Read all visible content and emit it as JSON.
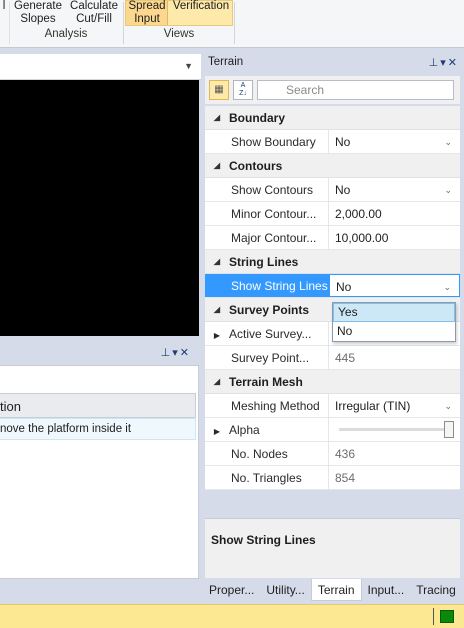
{
  "ribbon": {
    "partial_label": "l",
    "generate_slopes_label": "Generate\nSlopes",
    "calculate_cutfill_label": "Calculate\nCut/Fill",
    "spread_input_label": "Spread\nInput",
    "verification_label": "Verification",
    "analysis_group": "Analysis",
    "views_group": "Views"
  },
  "lower_grid": {
    "header": "tion",
    "row": "nove the platform inside it"
  },
  "dock": {
    "title": "Terrain",
    "search_placeholder": "Search",
    "categories": {
      "boundary": "Boundary",
      "contours": "Contours",
      "string_lines": "String Lines",
      "survey_points": "Survey Points",
      "terrain_mesh": "Terrain Mesh"
    },
    "props": {
      "show_boundary": {
        "name": "Show Boundary",
        "value": "No"
      },
      "show_contours": {
        "name": "Show Contours",
        "value": "No"
      },
      "minor_contour": {
        "name": "Minor Contour...",
        "value": "2,000.00"
      },
      "major_contour": {
        "name": "Major Contour...",
        "value": "10,000.00"
      },
      "show_string_lines": {
        "name": "Show String Lines",
        "value": "No"
      },
      "active_survey": {
        "name": "Active Survey...",
        "value": ""
      },
      "survey_point": {
        "name": "Survey Point...",
        "value": "445"
      },
      "meshing_method": {
        "name": "Meshing Method",
        "value": "Irregular (TIN)"
      },
      "alpha": {
        "name": "Alpha",
        "value": 1.0
      },
      "no_nodes": {
        "name": "No. Nodes",
        "value": "436"
      },
      "no_triangles": {
        "name": "No. Triangles",
        "value": "854"
      }
    },
    "dropdown_options": [
      "Yes",
      "No"
    ],
    "description_title": "Show String Lines"
  },
  "tabs": [
    "Proper...",
    "Utility...",
    "Terrain",
    "Input...",
    "Tracing"
  ],
  "active_tab": "Terrain",
  "colors": {
    "selection": "#3399ff",
    "status_bar": "#fce792",
    "status_led": "#0a8a0a",
    "ribbon_highlight": "#fde9a9"
  }
}
